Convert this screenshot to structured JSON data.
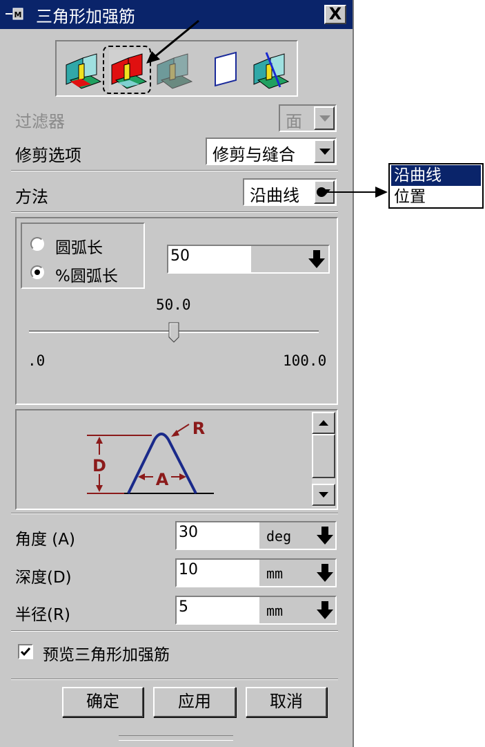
{
  "window": {
    "title": "三角形加强筋",
    "close_label": "X"
  },
  "toolbar": {
    "tools": [
      {
        "icon": "rib-on-faces-icon",
        "selected": false
      },
      {
        "icon": "rib-on-curve-icon",
        "selected": true
      },
      {
        "icon": "rib-gray-icon",
        "selected": false
      },
      {
        "icon": "plane-icon",
        "selected": false
      },
      {
        "icon": "rib-by-plane-icon",
        "selected": false
      }
    ]
  },
  "filter": {
    "label": "过滤器",
    "value": "面"
  },
  "trim": {
    "label": "修剪选项",
    "value": "修剪与缝合"
  },
  "method": {
    "label": "方法",
    "value": "沿曲线",
    "options": [
      "沿曲线",
      "位置"
    ]
  },
  "position": {
    "arc_length_label": "圆弧长",
    "pct_arc_length_label": "%圆弧长",
    "selected": "pct_arc_length",
    "value": "50",
    "slider_value_text": "50.0",
    "slider_min": ".0",
    "slider_max": "100.0",
    "slider_fraction": 0.5
  },
  "diagram": {
    "label_r": "R",
    "label_d": "D",
    "label_a": "A"
  },
  "params": {
    "angle": {
      "label": "角度 (A)",
      "value": "30",
      "unit": "deg"
    },
    "depth": {
      "label": "深度(D)",
      "value": "10",
      "unit": "mm"
    },
    "radius": {
      "label": "半径(R)",
      "value": "5",
      "unit": "mm"
    }
  },
  "preview": {
    "label": "预览三角形加强筋",
    "checked": true
  },
  "buttons": {
    "ok": "确定",
    "apply": "应用",
    "cancel": "取消"
  },
  "colors": {
    "title_bar": "#0a246a",
    "dialog_bg": "#c8c8c8",
    "diagram": "#1a2a8a",
    "dimension": "#8b1a1a"
  }
}
